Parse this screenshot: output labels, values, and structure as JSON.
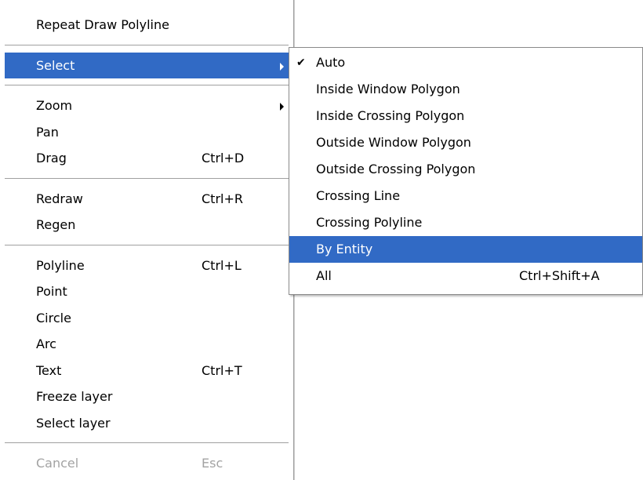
{
  "main_menu": {
    "repeat": "Repeat Draw Polyline",
    "select": "Select",
    "zoom": "Zoom",
    "pan": "Pan",
    "drag": "Drag",
    "drag_shortcut": "Ctrl+D",
    "redraw": "Redraw",
    "redraw_shortcut": "Ctrl+R",
    "regen": "Regen",
    "polyline": "Polyline",
    "polyline_shortcut": "Ctrl+L",
    "point": "Point",
    "circle": "Circle",
    "arc": "Arc",
    "text": "Text",
    "text_shortcut": "Ctrl+T",
    "freeze_layer": "Freeze layer",
    "select_layer": "Select layer",
    "cancel": "Cancel",
    "cancel_shortcut": "Esc"
  },
  "select_submenu": {
    "check_glyph": "✔",
    "auto": "Auto",
    "inside_window_polygon": "Inside Window Polygon",
    "inside_crossing_polygon": "Inside Crossing Polygon",
    "outside_window_polygon": "Outside Window Polygon",
    "outside_crossing_polygon": "Outside Crossing Polygon",
    "crossing_line": "Crossing Line",
    "crossing_polyline": "Crossing Polyline",
    "by_entity": "By Entity",
    "all": "All",
    "all_shortcut": "Ctrl+Shift+A"
  },
  "colors": {
    "highlight": "#316ac5",
    "disabled_text": "#a3a3a3"
  }
}
